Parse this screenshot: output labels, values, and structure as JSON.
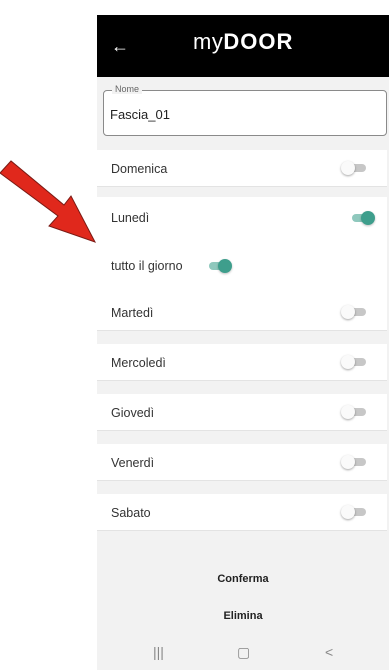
{
  "header": {
    "back_icon": "arrow-left-icon",
    "logo_my": "my",
    "logo_door": "DOOR"
  },
  "name_field": {
    "label": "Nome",
    "value": "Fascia_01"
  },
  "days": [
    {
      "label": "Domenica",
      "on": false
    },
    {
      "label": "Lunedì",
      "on": true
    },
    {
      "label": "Martedì",
      "on": false
    },
    {
      "label": "Mercoledì",
      "on": false
    },
    {
      "label": "Giovedì",
      "on": false
    },
    {
      "label": "Venerdì",
      "on": false
    },
    {
      "label": "Sabato",
      "on": false
    }
  ],
  "all_day": {
    "label": "tutto il giorno",
    "on": true
  },
  "actions": {
    "confirm": "Conferma",
    "delete": "Elimina"
  },
  "nav": {
    "recents": "|||",
    "home": "▢",
    "back": "<"
  },
  "colors": {
    "toggle_on": "#3e9e8c",
    "toggle_off": "#c7c7c7",
    "arrow": "#e0281c"
  }
}
